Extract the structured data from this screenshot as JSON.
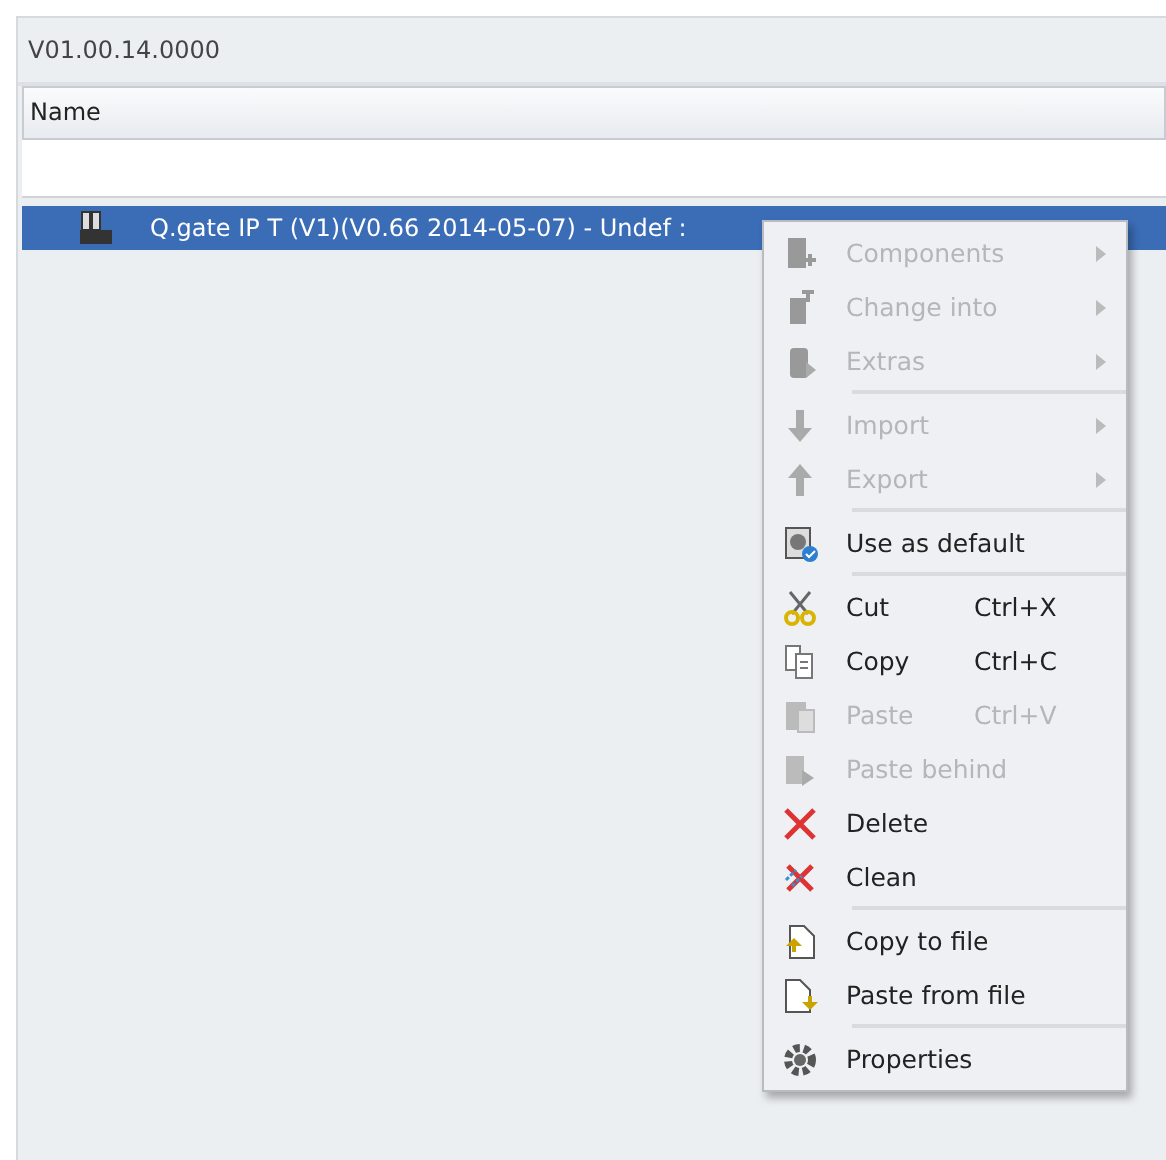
{
  "version": "V01.00.14.0000",
  "table": {
    "columns": [
      "Name"
    ],
    "rows": [
      {
        "name": "Q.gate IP T (V1)(V0.66 2014-05-07) - Undef :",
        "selected": true
      }
    ]
  },
  "context_menu": [
    {
      "kind": "submenu",
      "label": "Components",
      "disabled": true
    },
    {
      "kind": "submenu",
      "label": "Change into",
      "disabled": true
    },
    {
      "kind": "submenu",
      "label": "Extras",
      "disabled": true
    },
    {
      "kind": "separator"
    },
    {
      "kind": "submenu",
      "label": "Import",
      "disabled": true
    },
    {
      "kind": "submenu",
      "label": "Export",
      "disabled": true
    },
    {
      "kind": "separator"
    },
    {
      "kind": "command",
      "label": "Use as default",
      "disabled": false
    },
    {
      "kind": "separator"
    },
    {
      "kind": "command",
      "label": "Cut",
      "shortcut": "Ctrl+X",
      "disabled": false
    },
    {
      "kind": "command",
      "label": "Copy",
      "shortcut": "Ctrl+C",
      "disabled": false
    },
    {
      "kind": "command",
      "label": "Paste",
      "shortcut": "Ctrl+V",
      "disabled": true
    },
    {
      "kind": "command",
      "label": "Paste behind",
      "disabled": true
    },
    {
      "kind": "command",
      "label": "Delete",
      "disabled": false
    },
    {
      "kind": "command",
      "label": "Clean",
      "disabled": false
    },
    {
      "kind": "separator"
    },
    {
      "kind": "command",
      "label": "Copy to file",
      "disabled": false
    },
    {
      "kind": "command",
      "label": "Paste from file",
      "disabled": false
    },
    {
      "kind": "separator"
    },
    {
      "kind": "command",
      "label": "Properties",
      "disabled": false
    }
  ]
}
